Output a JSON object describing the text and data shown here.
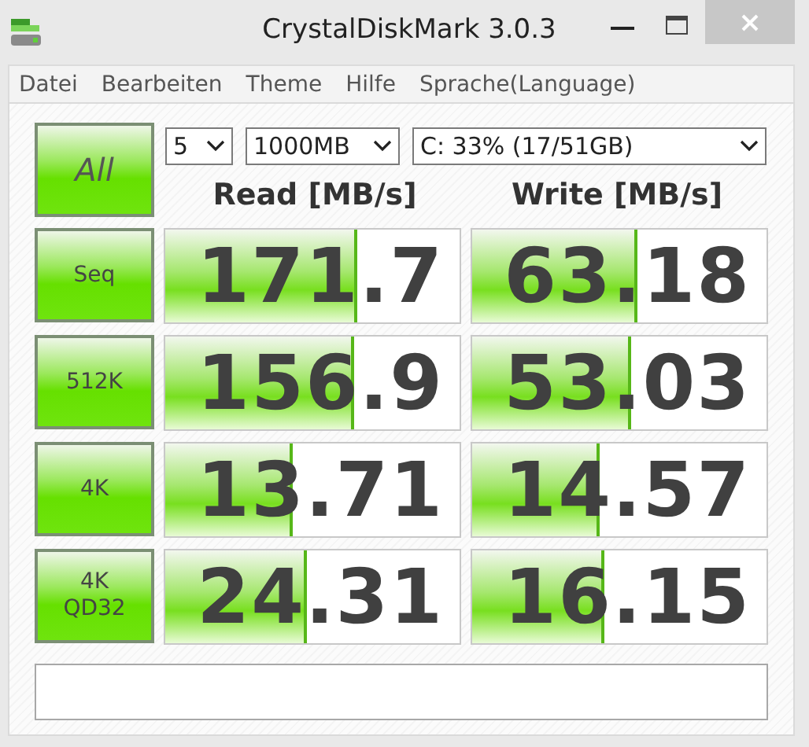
{
  "window": {
    "title": "CrystalDiskMark 3.0.3"
  },
  "menu": [
    "Datei",
    "Bearbeiten",
    "Theme",
    "Hilfe",
    "Sprache(Language)"
  ],
  "all_button": "All",
  "selectors": [
    {
      "value": "5"
    },
    {
      "value": "1000MB"
    },
    {
      "value": "C: 33% (17/51GB)"
    }
  ],
  "columns": [
    "Read [MB/s]",
    "Write [MB/s]"
  ],
  "rows": [
    {
      "test": "Seq",
      "read": {
        "value": "171.7",
        "level": 0.64
      },
      "write": {
        "value": "63.18",
        "level": 0.55
      }
    },
    {
      "test": "512K",
      "read": {
        "value": "156.9",
        "level": 0.63
      },
      "write": {
        "value": "53.03",
        "level": 0.53
      }
    },
    {
      "test": "4K",
      "read": {
        "value": "13.71",
        "level": 0.42
      },
      "write": {
        "value": "14.57",
        "level": 0.42
      }
    },
    {
      "test": "4K\nQD32",
      "read": {
        "value": "24.31",
        "level": 0.47
      },
      "write": {
        "value": "16.15",
        "level": 0.44
      }
    }
  ]
}
